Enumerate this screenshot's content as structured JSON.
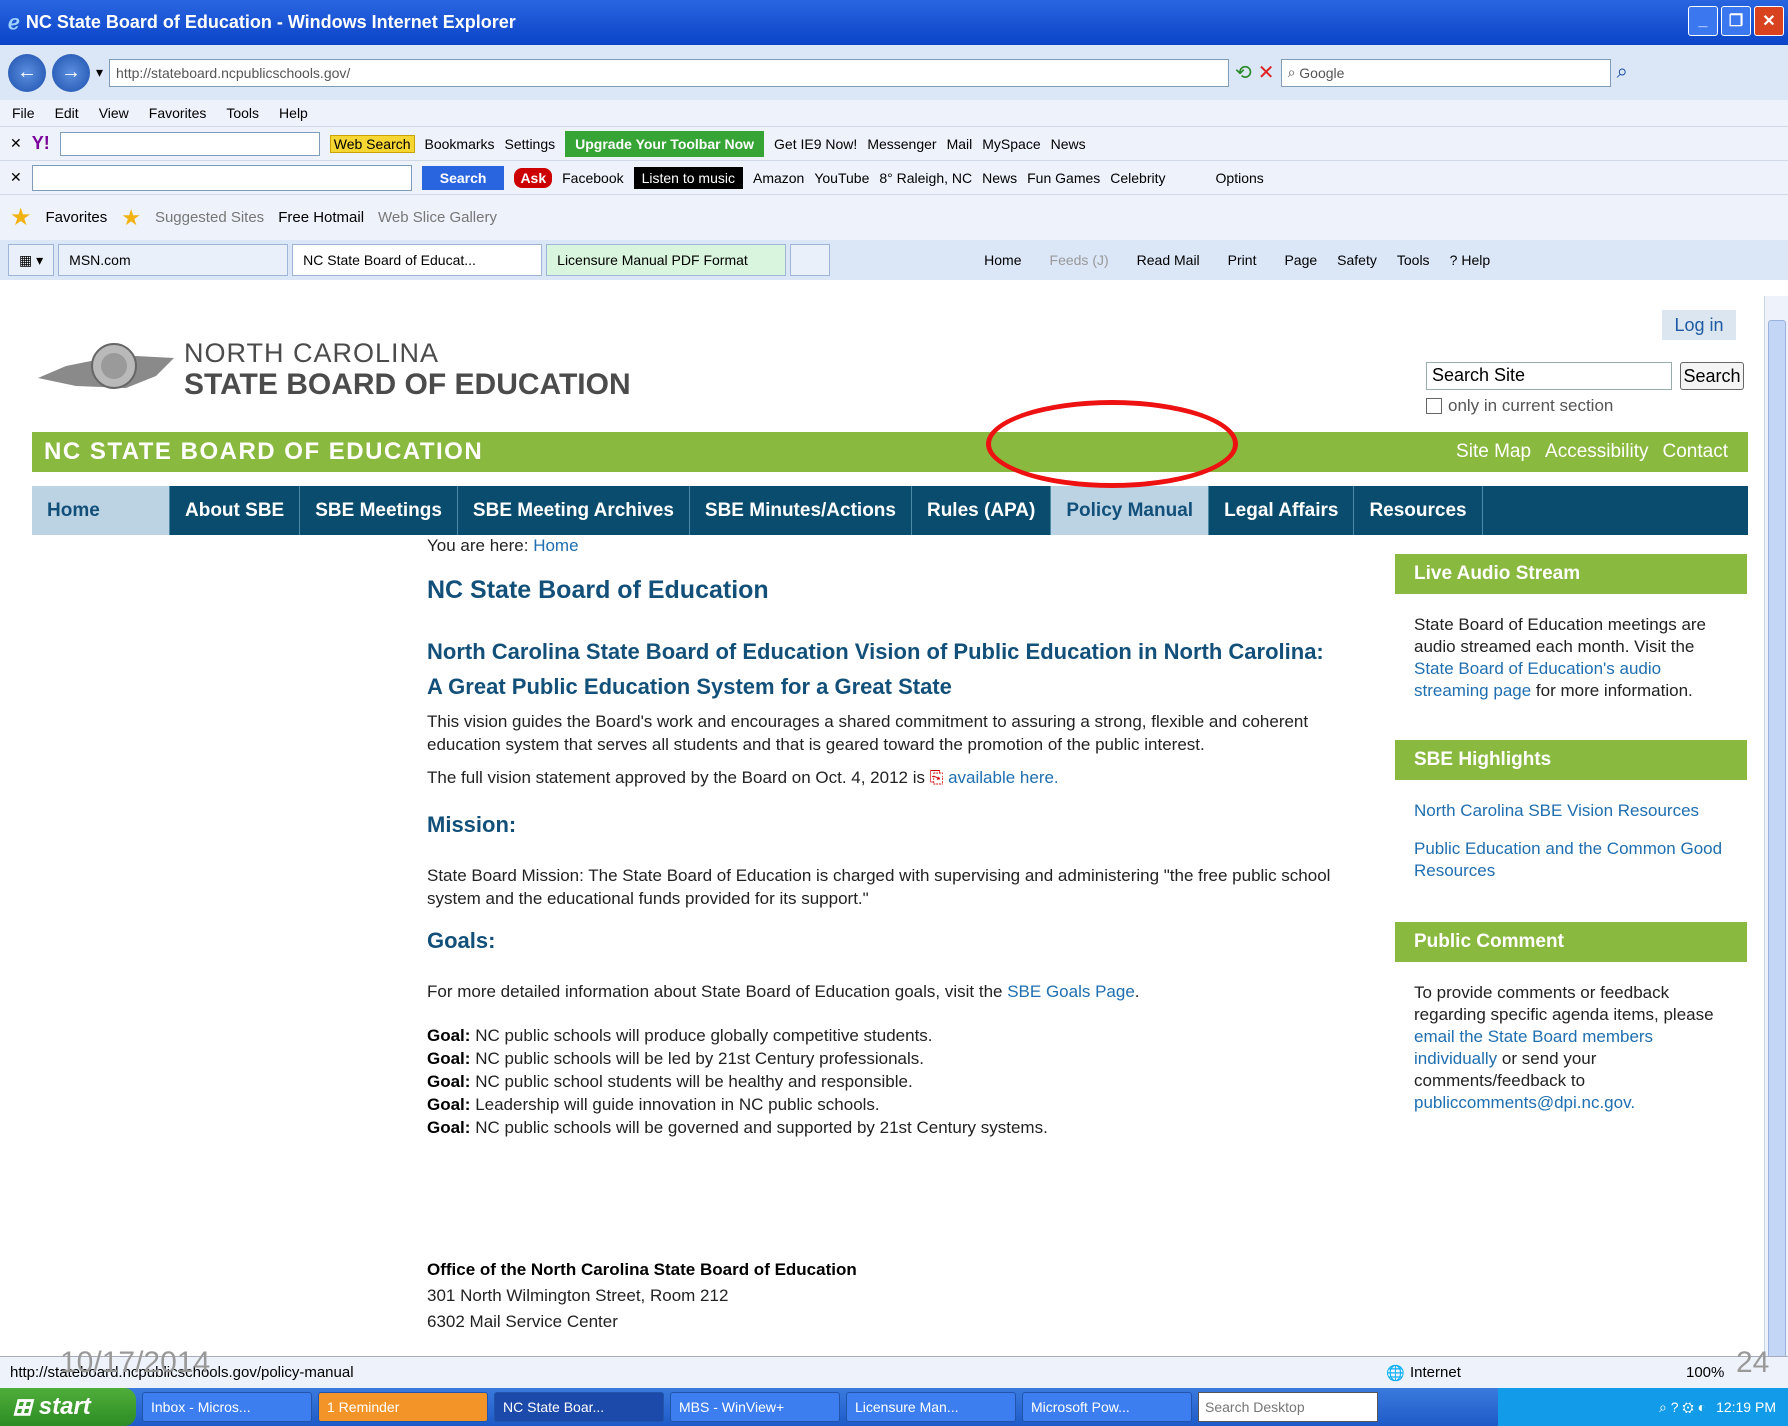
{
  "window": {
    "title": "NC State Board of Education - Windows Internet Explorer"
  },
  "address": {
    "url": "http://stateboard.ncpublicschools.gov/",
    "search_placeholder": "Google"
  },
  "menu": [
    "File",
    "Edit",
    "View",
    "Favorites",
    "Tools",
    "Help"
  ],
  "toolbar1": {
    "web_search": "Web Search",
    "bookmarks": "Bookmarks",
    "settings": "Settings",
    "upgrade": "Upgrade Your Toolbar Now",
    "get_ie9": "Get IE9 Now!",
    "messenger": "Messenger",
    "mail": "Mail",
    "myspace": "MySpace",
    "news": "News"
  },
  "toolbar2": {
    "search_btn": "Search",
    "facebook": "Facebook",
    "listen": "Listen to music",
    "amazon": "Amazon",
    "youtube": "YouTube",
    "weather": "8° Raleigh, NC",
    "news": "News",
    "fun_games": "Fun Games",
    "celebrity": "Celebrity",
    "options": "Options"
  },
  "favorites_bar": {
    "favorites": "Favorites",
    "suggested": "Suggested Sites",
    "hotmail": "Free Hotmail",
    "slice": "Web Slice Gallery"
  },
  "tabs": [
    "MSN.com",
    "NC State Board of Educat...",
    "Licensure Manual PDF Format"
  ],
  "cmdbar": {
    "home": "Home",
    "feeds": "Feeds (J)",
    "readmail": "Read Mail",
    "print": "Print",
    "page": "Page",
    "safety": "Safety",
    "tools": "Tools",
    "help": "Help"
  },
  "site": {
    "login": "Log in",
    "logo_line1": "NORTH CAROLINA",
    "logo_line2": "STATE BOARD OF EDUCATION",
    "search_value": "Search Site",
    "search_btn": "Search",
    "only_section": "only in current section",
    "banner": "NC STATE BOARD OF EDUCATION",
    "top_links": [
      "Site Map",
      "Accessibility",
      "Contact"
    ],
    "nav": [
      "Home",
      "About SBE",
      "SBE Meetings",
      "SBE Meeting Archives",
      "SBE Minutes/Actions",
      "Rules (APA)",
      "Policy Manual",
      "Legal Affairs",
      "Resources"
    ]
  },
  "main": {
    "breadcrumb_prefix": "You are here: ",
    "breadcrumb_link": "Home",
    "title": "NC State Board of Education",
    "vision_heading": "North Carolina State Board of Education Vision of Public Education in North Carolina: A Great Public Education System for a Great State",
    "vision_text": "This vision guides the Board's work and encourages a shared commitment to assuring a strong, flexible and coherent education system that serves all students and that is geared toward the promotion of the public interest.",
    "full_vision_prefix": "The full vision statement approved by the Board on Oct. 4, 2012 is ",
    "full_vision_link": "available here.",
    "mission_heading": "Mission:",
    "mission_text": "State Board Mission: The State Board of Education is charged with supervising and administering \"the free public school system and the educational funds provided for its support.\"",
    "goals_heading": "Goals:",
    "goals_intro": "For more detailed information about State Board of Education goals, visit the ",
    "goals_link": "SBE Goals Page",
    "goal_label": "Goal:",
    "goals": [
      "NC public schools will produce globally competitive students.",
      "NC public schools will be led by 21st Century professionals.",
      "NC public school students will be healthy and responsible.",
      "Leadership will guide innovation in NC public schools.",
      "NC public schools will be governed and supported by 21st Century systems."
    ],
    "office_heading": "Office of the North Carolina State Board of Education",
    "office_addr1": "301 North Wilmington Street, Room 212",
    "office_addr2": "6302 Mail Service Center"
  },
  "sidebar": {
    "audio_head": "Live Audio Stream",
    "audio_text_a": "State Board of Education meetings are audio streamed each month. Visit the ",
    "audio_link": "State Board of Education's audio streaming page",
    "audio_text_b": " for more information.",
    "highlights_head": "SBE Highlights",
    "highlight_links": [
      "North Carolina SBE Vision Resources",
      "Public Education and the Common Good Resources"
    ],
    "comment_head": "Public Comment",
    "comment_a": "To provide comments or feedback regarding specific agenda items, please ",
    "comment_link": "email the State Board members individually",
    "comment_b": " or send your comments/feedback to ",
    "comment_email": "publiccomments@dpi.nc.gov."
  },
  "status": {
    "url": "http://stateboard.ncpublicschools.gov/policy-manual",
    "zone": "Internet",
    "zoom": "100%",
    "date_stamp": "10/17/2014",
    "page_num": "24"
  },
  "taskbar": {
    "start": "start",
    "items": [
      "Inbox - Micros...",
      "1 Reminder",
      "NC State Boar...",
      "MBS - WinView+",
      "Licensure Man...",
      "Microsoft Pow..."
    ],
    "desk_search": "Search Desktop",
    "clock": "12:19 PM"
  }
}
